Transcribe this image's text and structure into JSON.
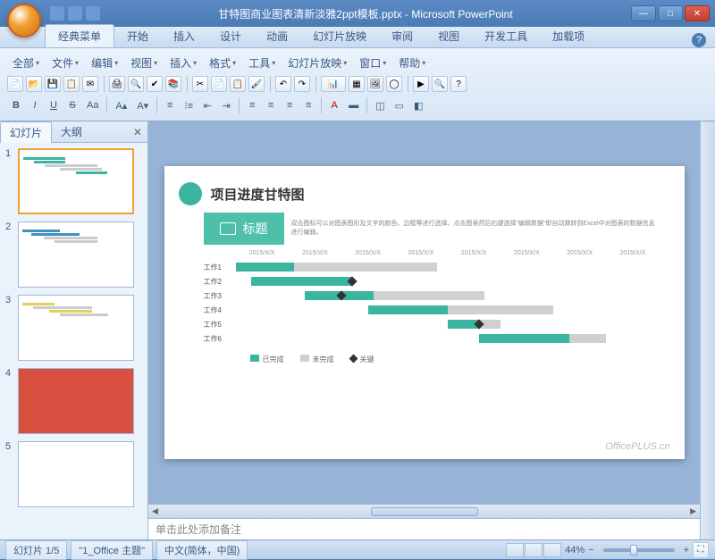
{
  "window": {
    "title": "甘特图商业图表清新淡雅2ppt模板.pptx - Microsoft PowerPoint",
    "app": "Microsoft PowerPoint"
  },
  "ribbon": {
    "tabs": [
      "经典菜单",
      "开始",
      "插入",
      "设计",
      "动画",
      "幻灯片放映",
      "审阅",
      "视图",
      "开发工具",
      "加载项"
    ],
    "active_tab": 0,
    "menus": [
      "全部",
      "文件",
      "编辑",
      "视图",
      "插入",
      "格式",
      "工具",
      "幻灯片放映",
      "窗口",
      "帮助"
    ],
    "format_buttons": {
      "bold": "B",
      "italic": "I",
      "underline": "U",
      "strike": "S",
      "fontcase": "Aa"
    }
  },
  "outline": {
    "tabs": [
      "幻灯片",
      "大纲"
    ],
    "active": 0,
    "slides": [
      1,
      2,
      3,
      4,
      5
    ],
    "selected": 1
  },
  "slide": {
    "title": "项目进度甘特图",
    "title_box": "标题",
    "subtitle": "双击图标可以对图表图形及文字的颜色、边框等进行选择。点击图表然后右键选择\"编辑数据\"即自动跳转到Excel中对图表的数据信息进行编辑。",
    "watermark": "OfficePLUS.cn",
    "legend": {
      "done": "已完成",
      "todo": "未完成",
      "key": "关键"
    }
  },
  "chart_data": {
    "type": "bar",
    "orientation": "horizontal-gantt",
    "title": "项目进度甘特图",
    "x_axis_labels": [
      "2015/X/X",
      "2015/X/X",
      "2015/X/X",
      "2015/X/X",
      "2015/X/X",
      "2015/X/X",
      "2015/X/X",
      "2015/X/X"
    ],
    "x_range_units": 8,
    "tasks": [
      {
        "name": "工作1",
        "done": {
          "start": 0.0,
          "end": 1.1
        },
        "todo": {
          "start": 1.1,
          "end": 3.8
        },
        "milestone": null
      },
      {
        "name": "工作2",
        "done": {
          "start": 0.3,
          "end": 2.2
        },
        "todo": null,
        "milestone": 2.2
      },
      {
        "name": "工作3",
        "done": {
          "start": 1.3,
          "end": 2.6
        },
        "todo": {
          "start": 2.6,
          "end": 4.7
        },
        "milestone": 2.0
      },
      {
        "name": "工作4",
        "done": {
          "start": 2.5,
          "end": 4.0
        },
        "todo": {
          "start": 4.0,
          "end": 6.0
        },
        "milestone": null
      },
      {
        "name": "工作5",
        "done": {
          "start": 4.0,
          "end": 4.6
        },
        "todo": {
          "start": 4.6,
          "end": 5.0
        },
        "milestone": 4.6
      },
      {
        "name": "工作6",
        "done": {
          "start": 4.6,
          "end": 6.3
        },
        "todo": {
          "start": 6.3,
          "end": 7.0
        },
        "milestone": null
      }
    ],
    "legend": [
      "已完成",
      "未完成",
      "关键"
    ],
    "colors": {
      "done": "#3cb5a0",
      "todo": "#d0d0d0",
      "milestone": "#333333"
    }
  },
  "notes": {
    "placeholder": "单击此处添加备注"
  },
  "status": {
    "slide_counter": "幻灯片 1/5",
    "theme": "\"1_Office 主题\"",
    "language": "中文(简体，中国)",
    "zoom": "44%"
  }
}
